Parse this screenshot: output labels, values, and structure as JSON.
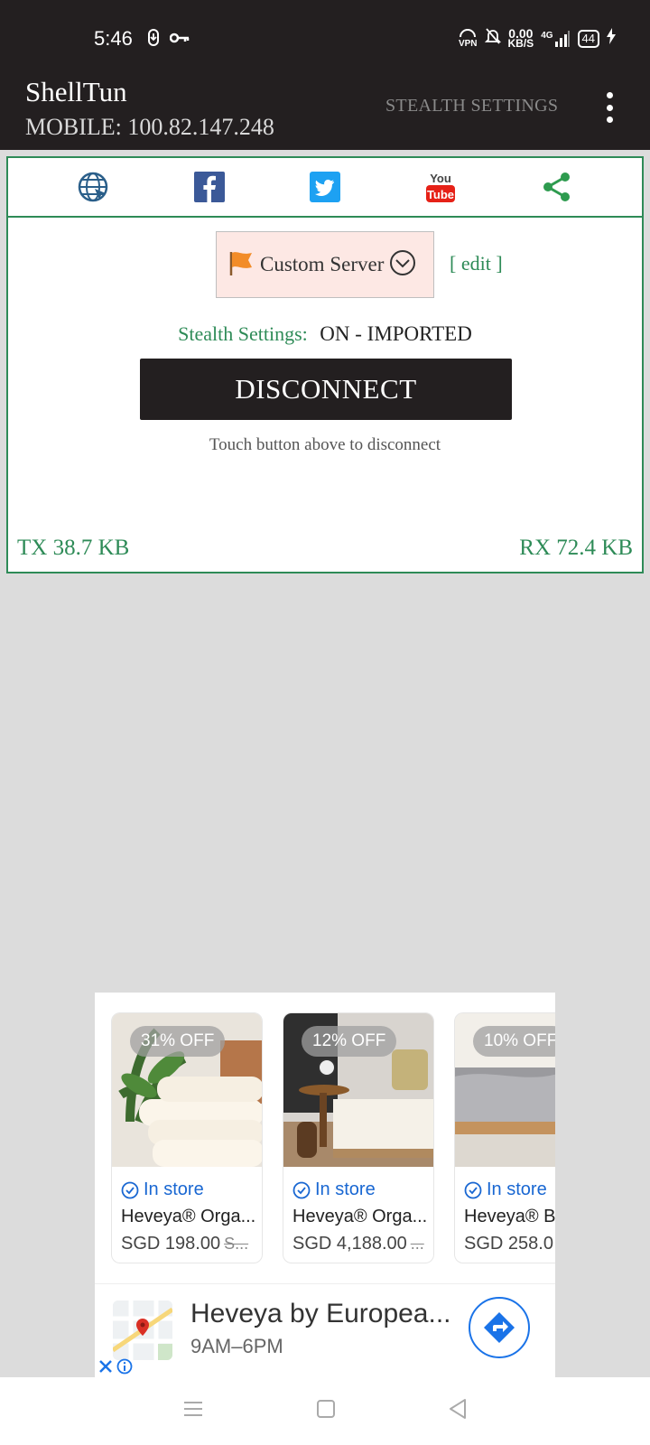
{
  "status_bar": {
    "time": "5:46",
    "net_speed_value": "0.00",
    "net_speed_unit": "KB/S",
    "network_type": "4G",
    "battery": "44",
    "vpn_label": "VPN"
  },
  "app_bar": {
    "title": "ShellTun",
    "ip_line": "MOBILE: 100.82.147.248",
    "stealth_settings_label": "STEALTH SETTINGS"
  },
  "social_icons": [
    "web-icon",
    "facebook-icon",
    "twitter-icon",
    "youtube-icon",
    "share-icon"
  ],
  "server": {
    "selected": "Custom Server",
    "edit_label": "[ edit ]"
  },
  "stealth": {
    "label": "Stealth Settings:",
    "value": "ON - IMPORTED"
  },
  "connection": {
    "button_label": "DISCONNECT",
    "hint": "Touch button above to disconnect"
  },
  "traffic": {
    "tx": "TX 38.7 KB",
    "rx": "RX 72.4 KB"
  },
  "ad": {
    "cards": [
      {
        "discount": "31% OFF",
        "availability": "In store",
        "name": "Heveya® Orga...",
        "price": "SGD 198.00",
        "old_price": "S..."
      },
      {
        "discount": "12% OFF",
        "availability": "In store",
        "name": "Heveya® Orga...",
        "price": "SGD 4,188.00",
        "old_price": "..."
      },
      {
        "discount": "10% OFF",
        "availability": "In store",
        "name": "Heveya® Ba",
        "price": "SGD 258.0",
        "old_price": ""
      }
    ],
    "store_name": "Heveya by Europea...",
    "store_hours": "9AM–6PM"
  },
  "colors": {
    "accent_green": "#2e8b57",
    "dark": "#231f20",
    "facebook": "#3b5998",
    "twitter": "#1da1f2",
    "youtube": "#e62117",
    "link_blue": "#1a73e8"
  }
}
